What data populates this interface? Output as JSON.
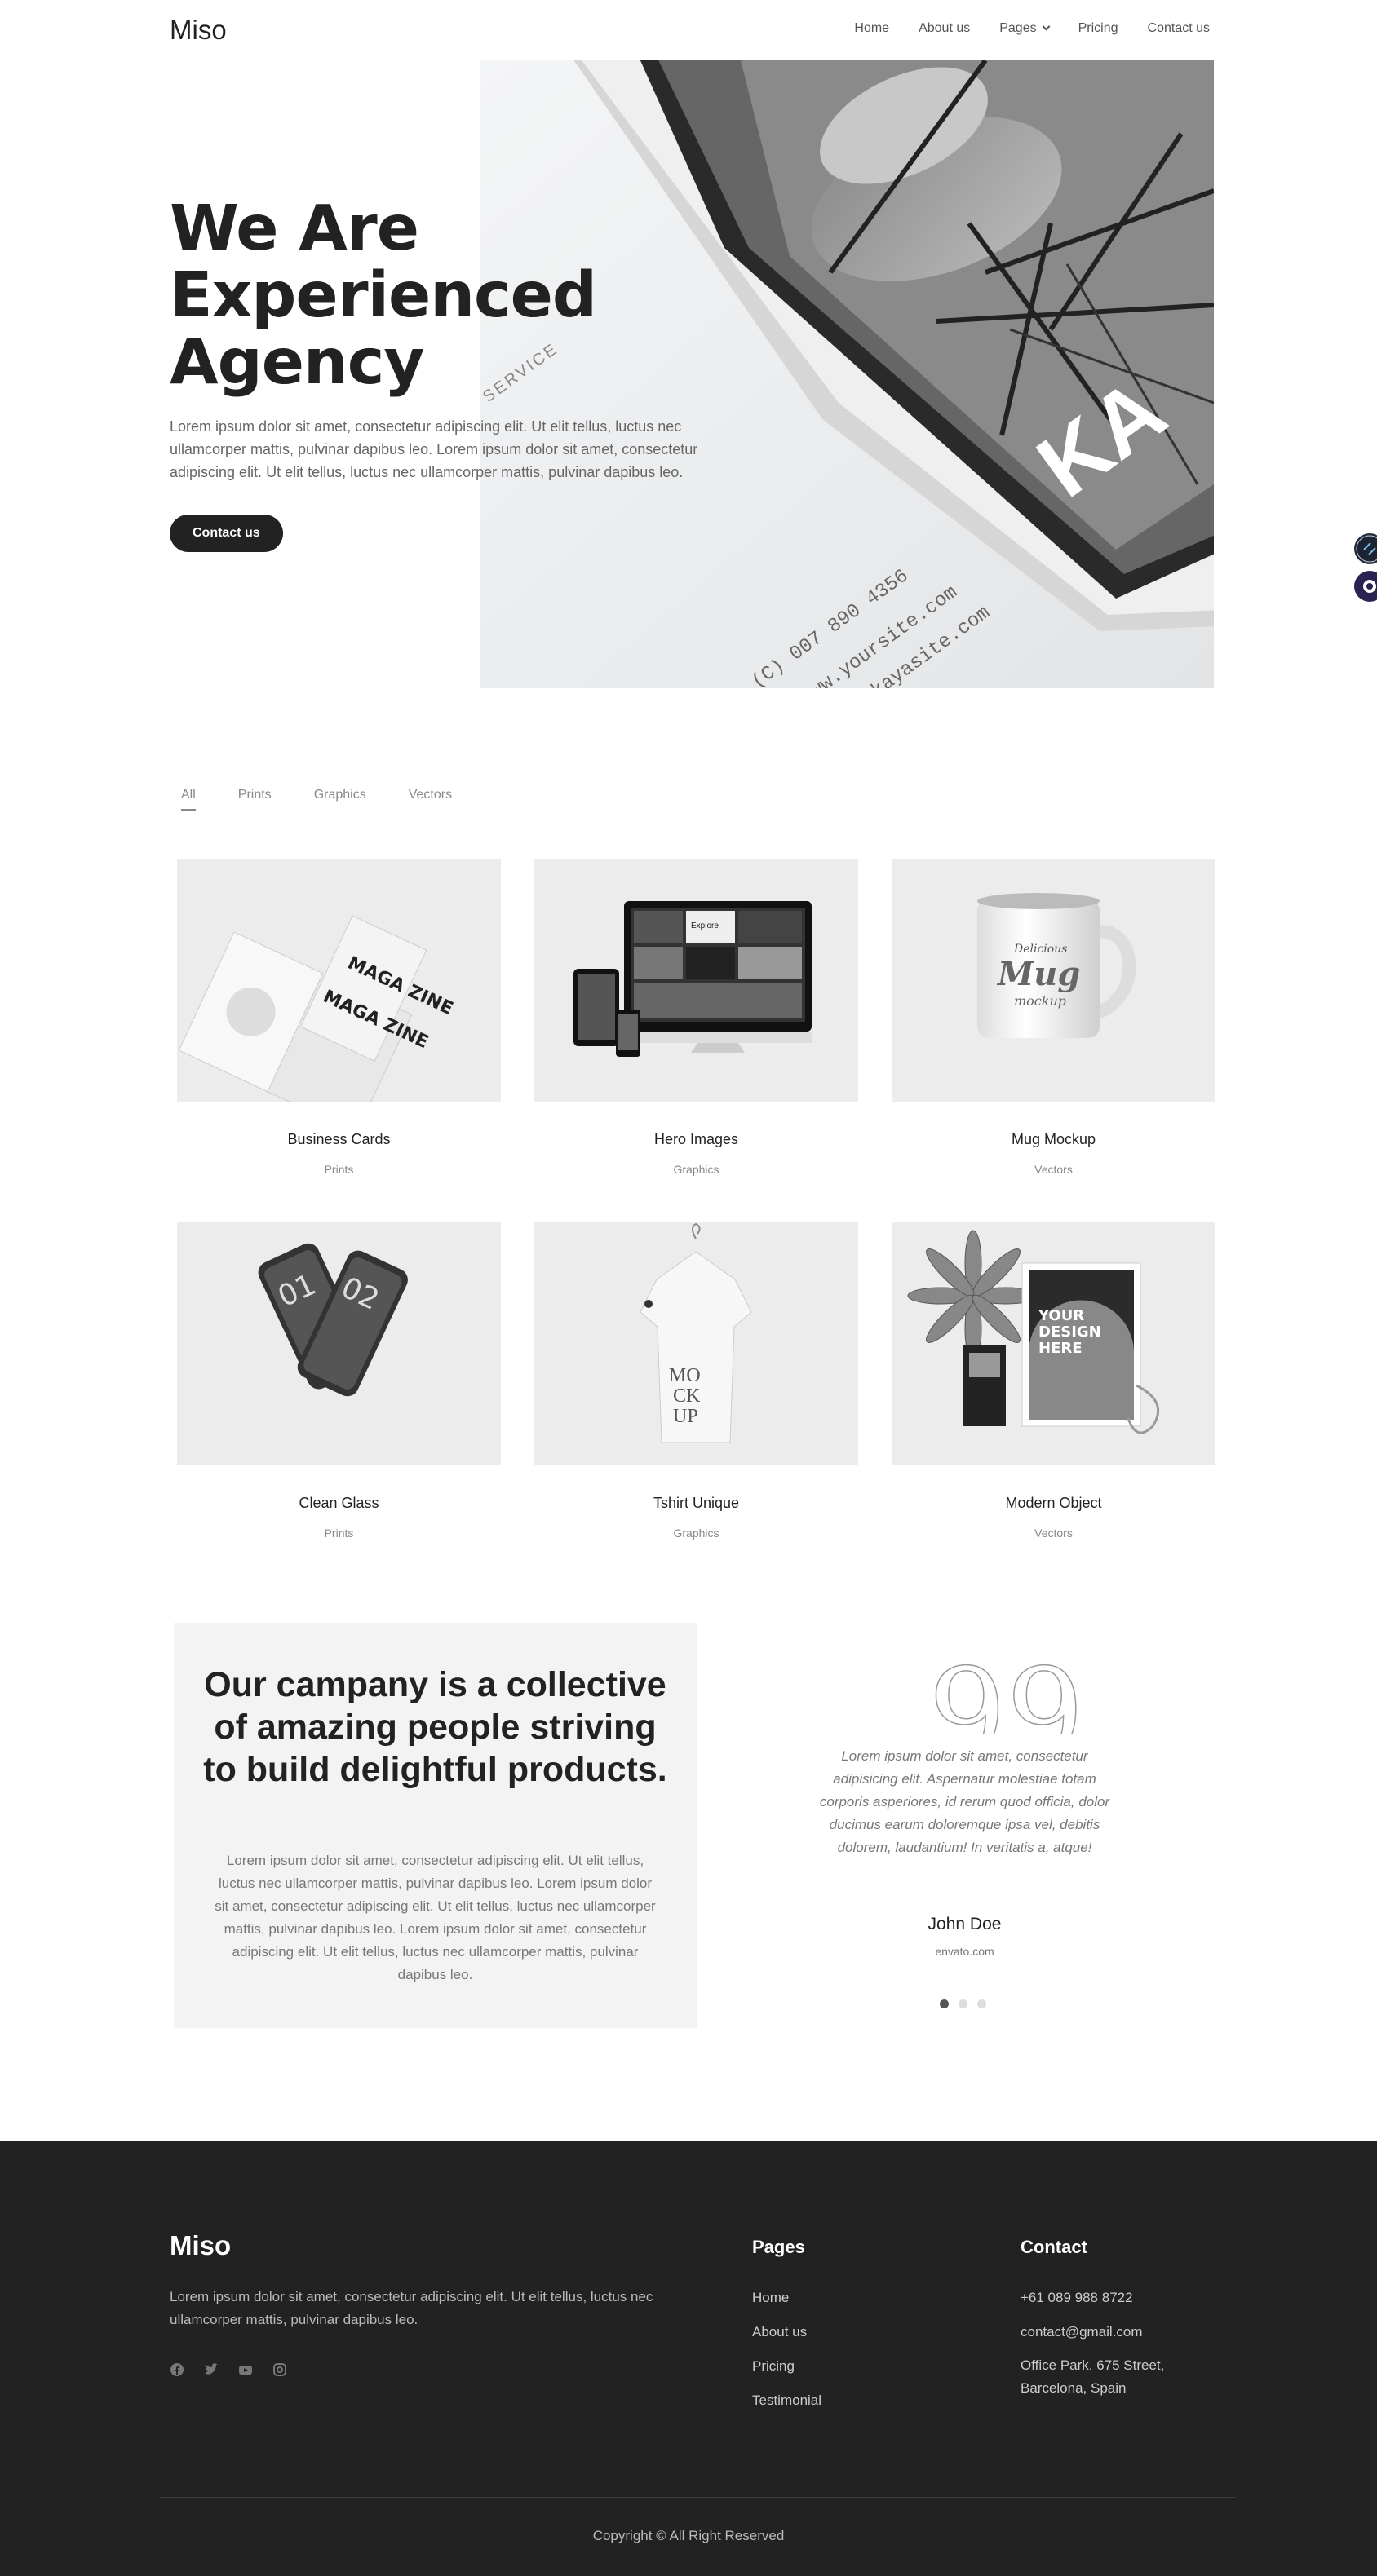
{
  "header": {
    "logo": "Miso",
    "nav": [
      "Home",
      "About us",
      "Pages",
      "Pricing",
      "Contact us"
    ]
  },
  "hero": {
    "title_line1": "We Are",
    "title_line2": "Experienced",
    "title_line3": "Agency",
    "text": "Lorem ipsum dolor sit amet, consectetur adipiscing elit. Ut elit tellus, luctus nec ullamcorper mattis, pulvinar dapibus leo. Lorem ipsum dolor sit amet, consectetur adipiscing elit. Ut elit tellus, luctus nec ullamcorper mattis, pulvinar dapibus leo.",
    "button": "Contact us",
    "image_text_brand": "KA",
    "image_text_service": "SERVICE",
    "image_text_phone": "(C) 007 890 4356",
    "image_text_site1": "www.yoursite.com",
    "image_text_site2": "www.kayasite.com"
  },
  "portfolio": {
    "filters": [
      "All",
      "Prints",
      "Graphics",
      "Vectors"
    ],
    "items": [
      {
        "title": "Business Cards",
        "category": "Prints",
        "art": [
          "MAGA ZINE",
          "MAGA ZINE"
        ]
      },
      {
        "title": "Hero Images",
        "category": "Graphics",
        "art": [
          "Explore"
        ]
      },
      {
        "title": "Mug Mockup",
        "category": "Vectors",
        "art": [
          "Delicious",
          "Mug",
          "mockup"
        ]
      },
      {
        "title": "Clean Glass",
        "category": "Prints",
        "art": [
          "01",
          "02"
        ]
      },
      {
        "title": "Tshirt Unique",
        "category": "Graphics",
        "art": [
          "MO",
          "CK",
          "UP"
        ]
      },
      {
        "title": "Modern Object",
        "category": "Vectors",
        "art": [
          "YOUR",
          "DESIGN",
          "HERE"
        ]
      }
    ]
  },
  "about": {
    "title": "Our campany is a collective of amazing people striving to build delightful products.",
    "text": "Lorem ipsum dolor sit amet, consectetur adipiscing elit. Ut elit tellus, luctus nec ullamcorper mattis, pulvinar dapibus leo. Lorem ipsum dolor sit amet, consectetur adipiscing elit. Ut elit tellus, luctus nec ullamcorper mattis, pulvinar dapibus leo. Lorem ipsum dolor sit amet, consectetur adipiscing elit. Ut elit tellus, luctus nec ullamcorper mattis, pulvinar dapibus leo."
  },
  "testimonial": {
    "quote_mark": "99",
    "text": "Lorem ipsum dolor sit amet, consectetur adipisicing elit. Aspernatur molestiae totam corporis asperiores, id rerum quod officia, dolor ducimus earum doloremque ipsa vel, debitis dolorem, laudantium! In veritatis a, atque!",
    "name": "John Doe",
    "source": "envato.com"
  },
  "footer": {
    "logo": "Miso",
    "text": "Lorem ipsum dolor sit amet, consectetur adipiscing elit. Ut elit tellus, luctus nec ullamcorper mattis, pulvinar dapibus leo.",
    "social_icons": [
      "facebook-icon",
      "twitter-icon",
      "youtube-icon",
      "instagram-icon"
    ],
    "pages_title": "Pages",
    "pages_links": [
      "Home",
      "About us",
      "Pricing",
      "Testimonial"
    ],
    "contact_title": "Contact",
    "phone": "+61 089 988 8722",
    "email": "contact@gmail.com",
    "address": "Office Park. 675 Street, Barcelona, Spain",
    "copyright": "Copyright © All Right Reserved"
  }
}
